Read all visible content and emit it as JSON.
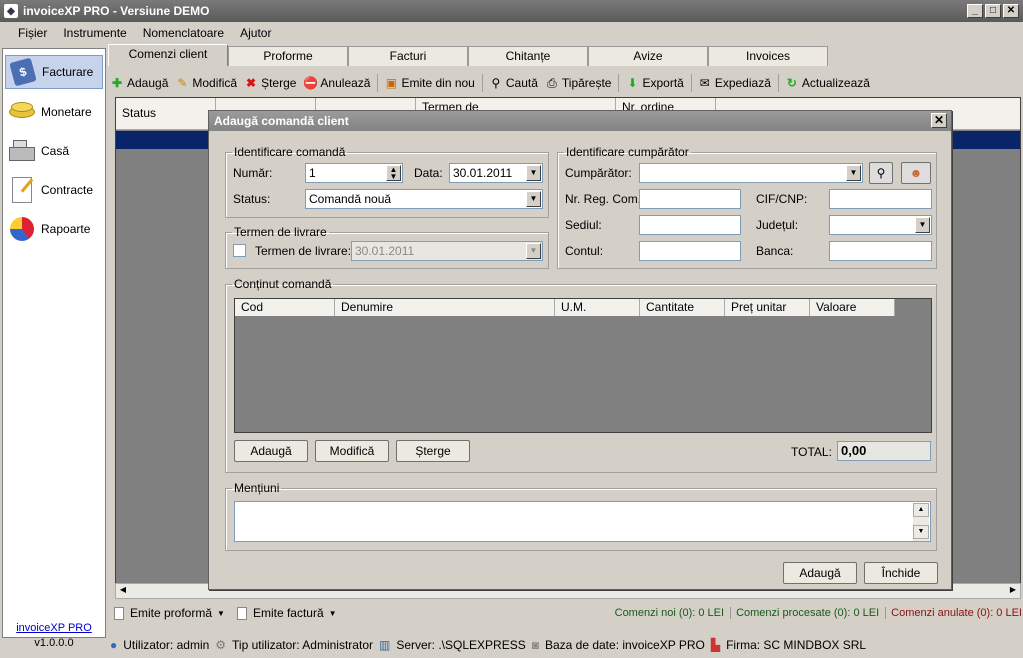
{
  "app": {
    "title": "invoiceXP PRO - Versiune DEMO",
    "version_name": "invoiceXP PRO",
    "version": "v1.0.0.0"
  },
  "menu": [
    "Fișier",
    "Instrumente",
    "Nomenclatoare",
    "Ajutor"
  ],
  "sidebar": [
    {
      "label": "Facturare",
      "icon": "invoice-icon"
    },
    {
      "label": "Monetare",
      "icon": "coins-icon"
    },
    {
      "label": "Casă",
      "icon": "cash-register-icon"
    },
    {
      "label": "Contracte",
      "icon": "contract-icon"
    },
    {
      "label": "Rapoarte",
      "icon": "pie-chart-icon"
    }
  ],
  "tabs": [
    "Comenzi client",
    "Proforme",
    "Facturi",
    "Chitanțe",
    "Avize",
    "Invoices"
  ],
  "toolbar": [
    "Adaugă",
    "Modifică",
    "Șterge",
    "Anulează",
    "Emite din nou",
    "Caută",
    "Tipărește",
    "Exportă",
    "Expediază",
    "Actualizează"
  ],
  "grid": {
    "headers": [
      "Status",
      "",
      "",
      "Termen de",
      "",
      "Nr. ordine"
    ]
  },
  "bottom": {
    "emite_proforma": "Emite proformă",
    "emite_factura": "Emite factură",
    "noi": "Comenzi noi (0): 0 LEI",
    "procesate": "Comenzi procesate (0): 0 LEI",
    "anulate": "Comenzi anulate (0): 0 LEI"
  },
  "status": {
    "user": "Utilizator: admin",
    "type": "Tip utilizator: Administrator",
    "server": "Server: .\\SQLEXPRESS",
    "db": "Baza de date: invoiceXP PRO",
    "firm": "Firma: SC MINDBOX SRL"
  },
  "dialog": {
    "title": "Adaugă comandă client",
    "ident": {
      "legend": "Identificare comandă",
      "numar_label": "Număr:",
      "numar": "1",
      "data_label": "Data:",
      "data": "30.01.2011",
      "status_label": "Status:",
      "status": "Comandă nouă"
    },
    "termen": {
      "legend": "Termen de livrare",
      "check_label": "Termen de livrare:",
      "value": "30.01.2011"
    },
    "cump": {
      "legend": "Identificare cumpărător",
      "cump_label": "Cumpărător:",
      "nrreg": "Nr. Reg. Com.:",
      "cif": "CIF/CNP:",
      "sediul": "Sediul:",
      "judet": "Județul:",
      "contul": "Contul:",
      "banca": "Banca:"
    },
    "continut": {
      "legend": "Conținut comandă",
      "cols": [
        "Cod",
        "Denumire",
        "U.M.",
        "Cantitate",
        "Preț unitar",
        "Valoare"
      ],
      "add": "Adaugă",
      "edit": "Modifică",
      "del": "Șterge",
      "total_label": "TOTAL:",
      "total": "0,00"
    },
    "mentiuni": {
      "legend": "Mențiuni"
    },
    "btn_add": "Adaugă",
    "btn_close": "Închide"
  }
}
